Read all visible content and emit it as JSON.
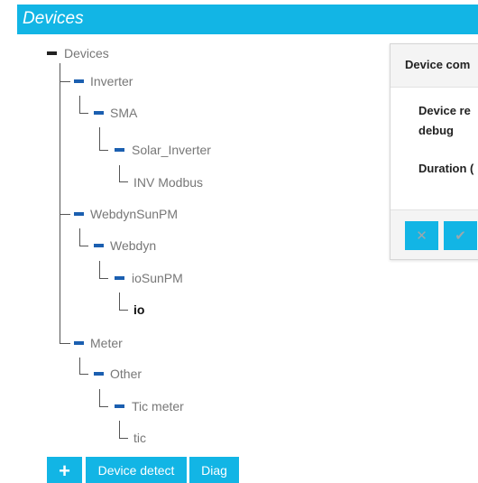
{
  "header": {
    "title": "Devices"
  },
  "tree": {
    "root": {
      "label": "Devices"
    },
    "nodes": [
      {
        "label": "Inverter"
      },
      {
        "label": "SMA"
      },
      {
        "label": "Solar_Inverter"
      },
      {
        "label": "INV Modbus"
      },
      {
        "label": "WebdynSunPM"
      },
      {
        "label": "Webdyn"
      },
      {
        "label": "ioSunPM"
      },
      {
        "label": "io"
      },
      {
        "label": "Meter"
      },
      {
        "label": "Other"
      },
      {
        "label": "Tic meter"
      },
      {
        "label": "tic"
      }
    ]
  },
  "buttons": {
    "add": "+",
    "detect": "Device detect",
    "diag": "Diag"
  },
  "panel": {
    "title": "Device com",
    "line1": "Device re",
    "line2": "debug",
    "line3": "Duration (",
    "cancel_icon": "✕",
    "ok_icon": "✔"
  },
  "colors": {
    "accent": "#12b5e5",
    "collapse_blue": "#1b5fb0",
    "label_gray": "#777777"
  },
  "icons": {
    "add": "plus-icon",
    "cancel": "close-icon",
    "ok": "check-icon"
  }
}
